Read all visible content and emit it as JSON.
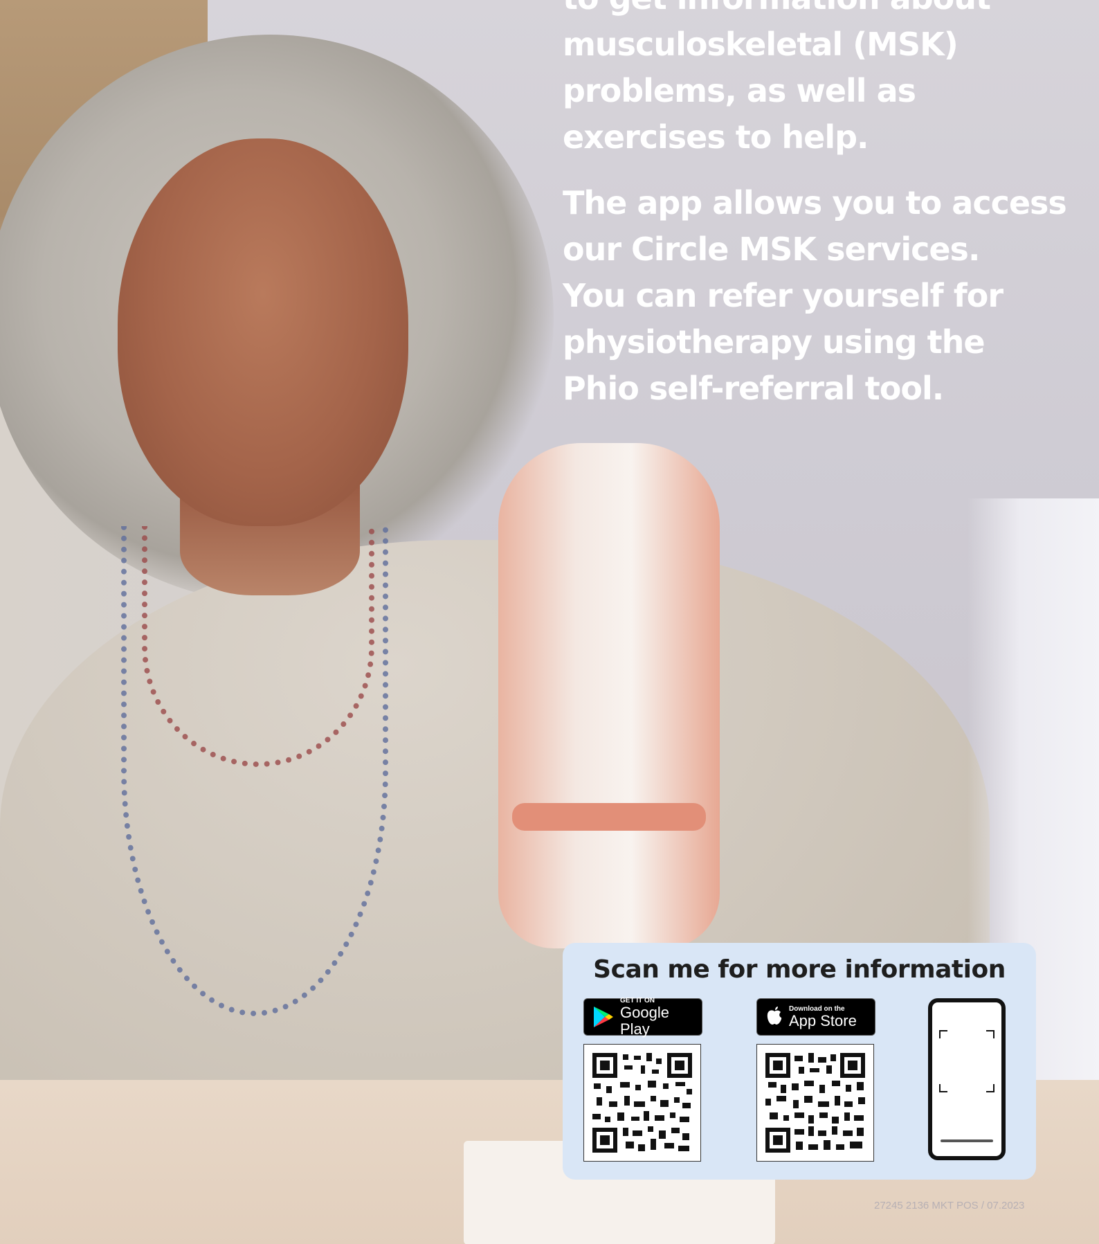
{
  "body_copy": {
    "para1_lines": [
      "to get information about",
      "musculoskeletal (MSK)",
      "problems, as well as",
      "exercises to help."
    ],
    "para2_lines": [
      "The app allows you to access",
      "our Circle MSK services.",
      "You can refer yourself for",
      "physiotherapy using the",
      "Phio self-referral tool."
    ]
  },
  "scan_panel": {
    "title": "Scan me for more information",
    "google_play": {
      "small": "GET IT ON",
      "big": "Google Play",
      "icon": "google-play-icon"
    },
    "app_store": {
      "small": "Download on the",
      "big": "App Store",
      "icon": "apple-icon"
    },
    "phone_icon": "phone-scan-icon",
    "panel_color": "#d9e6f6"
  },
  "footer": {
    "reference": "27245 2136 MKT POS / 07.2023"
  },
  "colors": {
    "text_white": "#ffffff",
    "title_dark": "#1e1e1e"
  }
}
